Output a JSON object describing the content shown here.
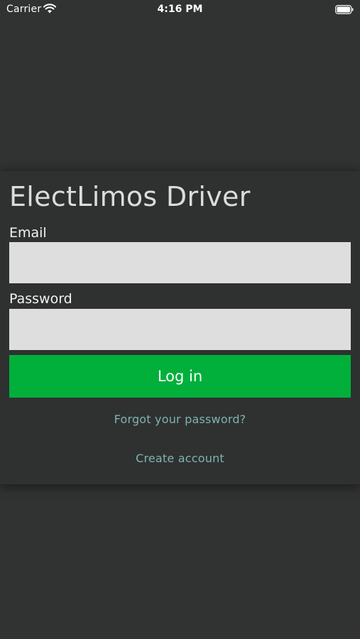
{
  "status_bar": {
    "carrier": "Carrier",
    "time": "4:16 PM",
    "wifi_icon": "wifi-icon",
    "battery_icon": "battery-icon"
  },
  "login": {
    "title": "ElectLimos Driver",
    "email_label": "Email",
    "email_value": "",
    "password_label": "Password",
    "password_value": "",
    "login_button": "Log in",
    "forgot_password": "Forgot your password?",
    "create_account": "Create account"
  },
  "colors": {
    "background": "#313232",
    "card": "#2f3131",
    "field": "#dedede",
    "primary_button": "#00b03b",
    "link": "#7fb3ad"
  }
}
